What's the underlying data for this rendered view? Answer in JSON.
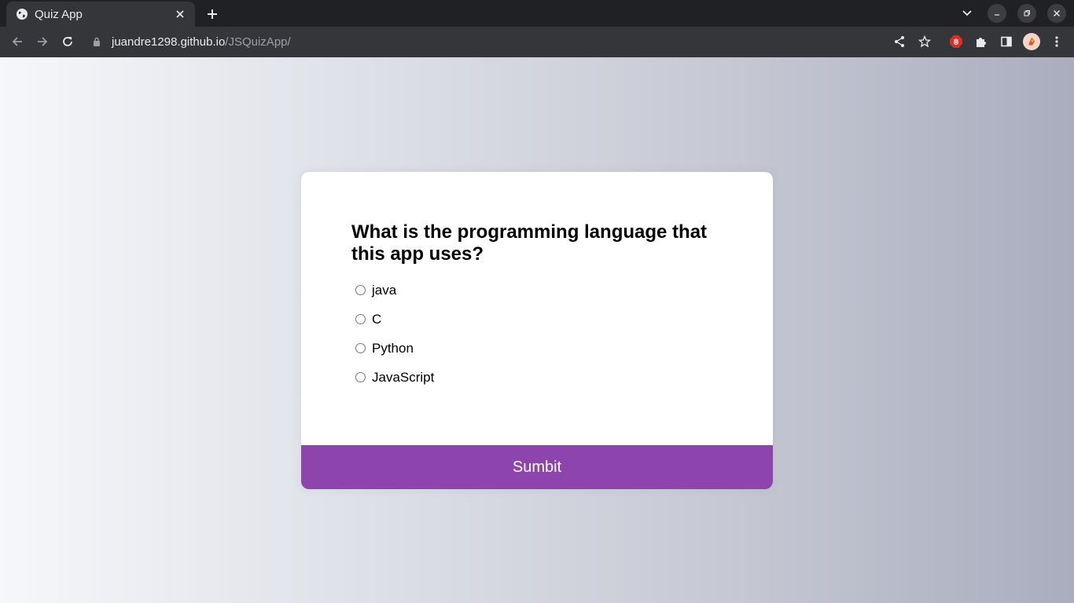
{
  "browser": {
    "tab": {
      "title": "Quiz App",
      "favicon": "globe-icon"
    },
    "url": {
      "host": "juandre1298.github.io",
      "path": "/JSQuizApp/"
    },
    "toolbar_icons": [
      "share-icon",
      "star-icon",
      "extension-stop-icon",
      "puzzle-icon",
      "sidepanel-icon",
      "avatar",
      "menu-icon"
    ]
  },
  "quiz": {
    "question": "What is the programming language that this app uses?",
    "answers": [
      "java",
      "C",
      "Python",
      "JavaScript"
    ],
    "submit_label": "Sumbit",
    "accent_color": "#8e44ad"
  }
}
